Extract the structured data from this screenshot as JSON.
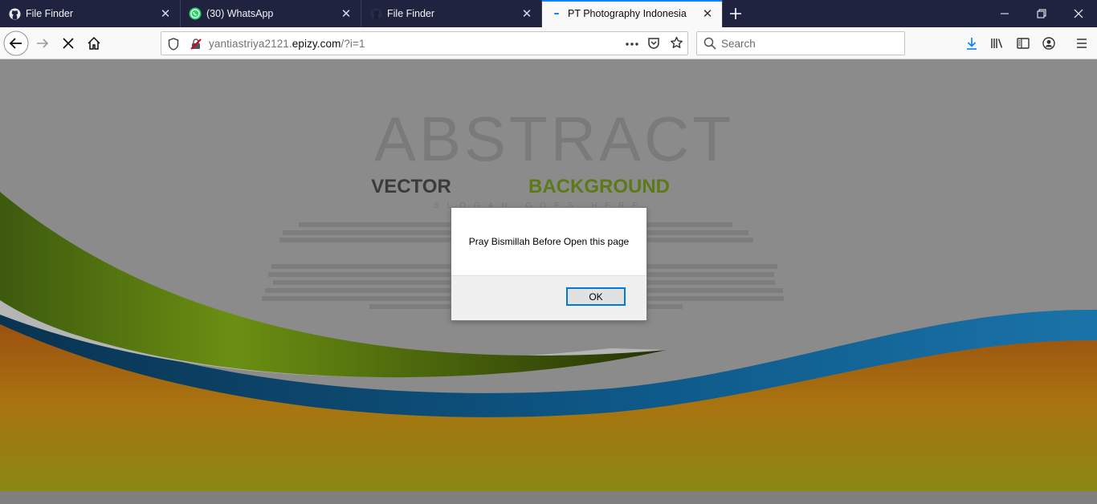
{
  "tabs": [
    {
      "title": "File Finder",
      "icon": "github-icon"
    },
    {
      "title": "(30) WhatsApp",
      "icon": "whatsapp-icon",
      "badge": "30"
    },
    {
      "title": "File Finder",
      "icon": "github-icon"
    },
    {
      "title": "PT Photography Indonesia",
      "icon": "loading-dot-icon",
      "active": true
    }
  ],
  "address": {
    "url_prefix": "yantiastriya2121.",
    "url_domain": "epizy.com",
    "url_suffix": "/?i=1"
  },
  "search": {
    "placeholder": "Search"
  },
  "page_image": {
    "title": "ABSTRACT",
    "subtitle_a": "VECTOR",
    "subtitle_b": "BACKGROUND",
    "slogan": "SLOGAN GOES HERE"
  },
  "dialog": {
    "message": "Pray Bismillah Before Open this page",
    "ok_label": "OK"
  },
  "colors": {
    "tabstrip": "#202340",
    "accent": "#0a84ff",
    "download": "#0a84ff"
  }
}
